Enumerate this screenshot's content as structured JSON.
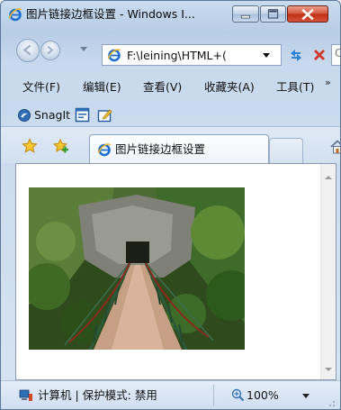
{
  "window": {
    "title": "图片链接边框设置 - Windows I..."
  },
  "navigation": {
    "address": "F:\\leining\\HTML+(",
    "search_placeholder": "C"
  },
  "menubar": {
    "items": [
      "文件(F)",
      "编辑(E)",
      "查看(V)",
      "收藏夹(A)",
      "工具(T)"
    ],
    "overflow": "»"
  },
  "linksbar": {
    "snagit_label": "SnagIt"
  },
  "tabs": {
    "active_label": "图片链接边框设置"
  },
  "statusbar": {
    "zone_text": "计算机 | 保护模式: 禁用",
    "zoom": "100%"
  },
  "icons": {
    "ie": "internet-explorer-icon",
    "back": "back-arrow-icon",
    "forward": "forward-arrow-icon",
    "refresh": "refresh-icon",
    "stop": "stop-icon",
    "snagit": "snagit-icon",
    "favorites": "favorites-star-icon",
    "add_favorite": "add-favorite-icon",
    "home": "home-icon",
    "computer": "computer-icon",
    "zoom": "zoom-icon"
  },
  "colors": {
    "close_button": "#c8391d",
    "chrome_blue": "#c9dbee",
    "content_bg": "#ffffff"
  }
}
